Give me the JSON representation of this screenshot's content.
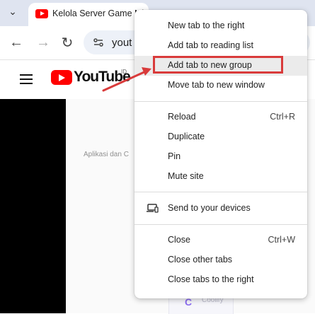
{
  "browser": {
    "tab_title": "Kelola Server Game Minecraft",
    "omnibox_text": "yout"
  },
  "youtube": {
    "wordmark": "YouTube",
    "country_code": "ID",
    "faint_label": "Aplikasi dan C",
    "card_text": "Coolify"
  },
  "context_menu": {
    "items": [
      {
        "label": "New tab to the right",
        "shortcut": ""
      },
      {
        "label": "Add tab to reading list",
        "shortcut": ""
      },
      {
        "label": "Add tab to new group",
        "shortcut": ""
      },
      {
        "label": "Move tab to new window",
        "shortcut": ""
      },
      {
        "label": "Reload",
        "shortcut": "Ctrl+R"
      },
      {
        "label": "Duplicate",
        "shortcut": ""
      },
      {
        "label": "Pin",
        "shortcut": ""
      },
      {
        "label": "Mute site",
        "shortcut": ""
      },
      {
        "label": "Send to your devices",
        "shortcut": ""
      },
      {
        "label": "Close",
        "shortcut": "Ctrl+W"
      },
      {
        "label": "Close other tabs",
        "shortcut": ""
      },
      {
        "label": "Close tabs to the right",
        "shortcut": ""
      }
    ]
  },
  "annotation": {
    "highlight_color": "#d93b3b"
  }
}
